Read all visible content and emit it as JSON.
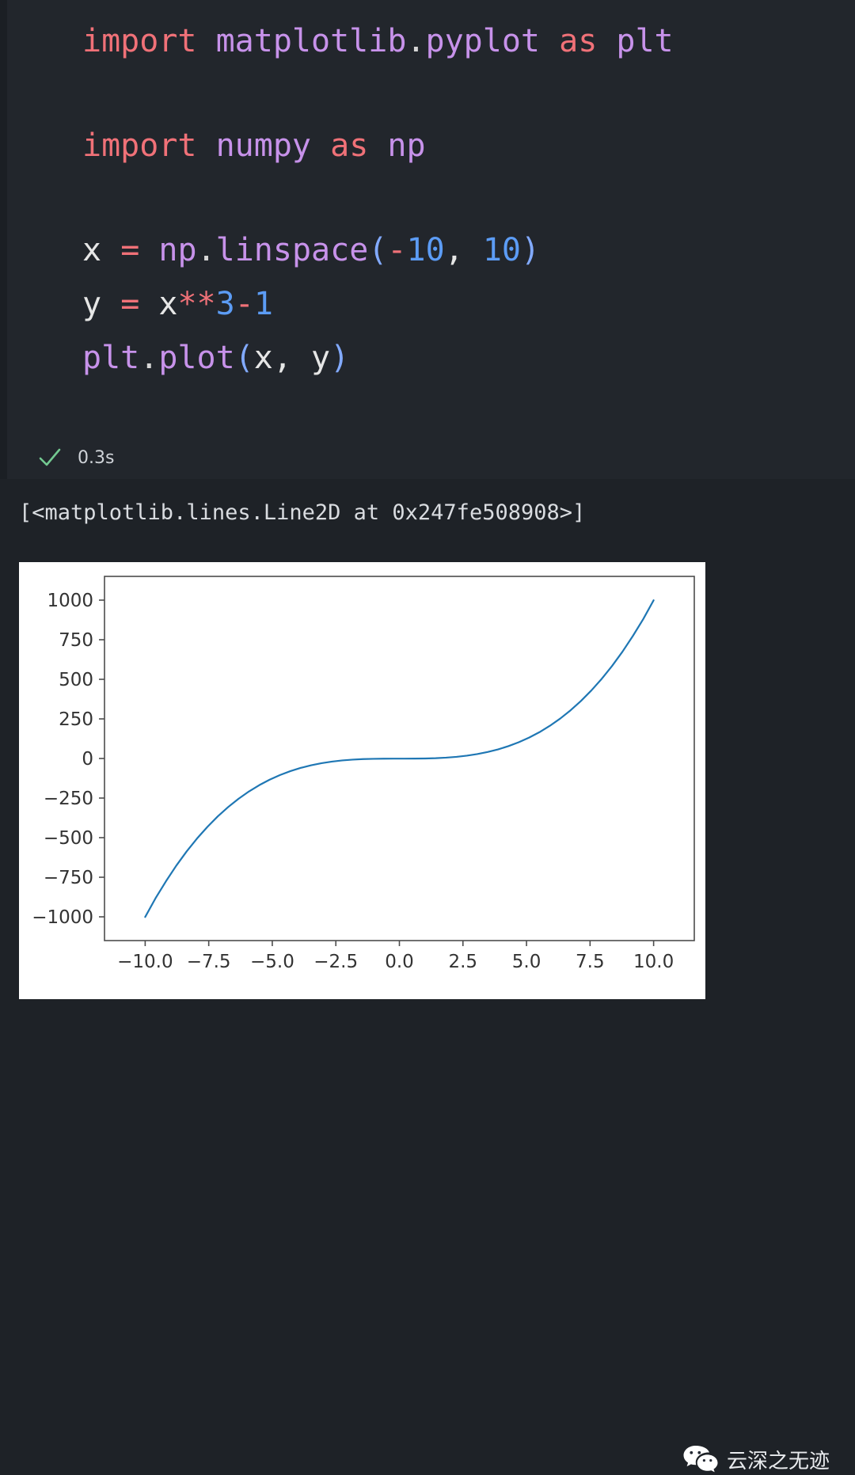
{
  "cell": {
    "code_lines": [
      {
        "id": "l1",
        "tokens": [
          {
            "t": "import",
            "c": "kw"
          },
          {
            "t": " ",
            "c": "plain"
          },
          {
            "t": "matplotlib",
            "c": "mod"
          },
          {
            "t": ".",
            "c": "plain"
          },
          {
            "t": "pyplot",
            "c": "mod"
          },
          {
            "t": " ",
            "c": "plain"
          },
          {
            "t": "as",
            "c": "kw"
          },
          {
            "t": " ",
            "c": "plain"
          },
          {
            "t": "plt",
            "c": "mod"
          }
        ]
      },
      {
        "id": "l2",
        "tokens": [
          {
            "t": "import",
            "c": "kw"
          },
          {
            "t": " ",
            "c": "plain"
          },
          {
            "t": "numpy",
            "c": "mod"
          },
          {
            "t": " ",
            "c": "plain"
          },
          {
            "t": "as",
            "c": "kw"
          },
          {
            "t": " ",
            "c": "plain"
          },
          {
            "t": "np",
            "c": "mod"
          }
        ]
      },
      {
        "id": "l3",
        "tokens": [
          {
            "t": "x",
            "c": "var"
          },
          {
            "t": " ",
            "c": "plain"
          },
          {
            "t": "=",
            "c": "op"
          },
          {
            "t": " ",
            "c": "plain"
          },
          {
            "t": "np",
            "c": "mod"
          },
          {
            "t": ".",
            "c": "plain"
          },
          {
            "t": "linspace",
            "c": "mod"
          },
          {
            "t": "(",
            "c": "punc"
          },
          {
            "t": "-",
            "c": "op"
          },
          {
            "t": "10",
            "c": "num"
          },
          {
            "t": ",",
            "c": "var"
          },
          {
            "t": " ",
            "c": "plain"
          },
          {
            "t": "10",
            "c": "num"
          },
          {
            "t": ")",
            "c": "punc"
          }
        ]
      },
      {
        "id": "l4",
        "tokens": [
          {
            "t": "y",
            "c": "var"
          },
          {
            "t": " ",
            "c": "plain"
          },
          {
            "t": "=",
            "c": "op"
          },
          {
            "t": " ",
            "c": "plain"
          },
          {
            "t": "x",
            "c": "var"
          },
          {
            "t": "**",
            "c": "op"
          },
          {
            "t": "3",
            "c": "num"
          },
          {
            "t": "-",
            "c": "op"
          },
          {
            "t": "1",
            "c": "num"
          }
        ]
      },
      {
        "id": "l5",
        "tokens": [
          {
            "t": "plt",
            "c": "mod"
          },
          {
            "t": ".",
            "c": "plain"
          },
          {
            "t": "plot",
            "c": "mod"
          },
          {
            "t": "(",
            "c": "punc"
          },
          {
            "t": "x",
            "c": "var"
          },
          {
            "t": ",",
            "c": "var"
          },
          {
            "t": " ",
            "c": "plain"
          },
          {
            "t": "y",
            "c": "var"
          },
          {
            "t": ")",
            "c": "punc"
          }
        ]
      }
    ],
    "code_plain": [
      "import matplotlib.pyplot as plt",
      "import numpy as np",
      "x = np.linspace(-10, 10)",
      "y = x**3-1",
      "plt.plot(x, y)"
    ],
    "status_icon": "check-icon",
    "status_color": "#73c991",
    "exec_time": "0.3s"
  },
  "output": {
    "repr_text": "[<matplotlib.lines.Line2D at 0x247fe508908>]"
  },
  "watermark": {
    "icon": "wechat-icon",
    "text": "云深之无迹"
  },
  "chart_data": {
    "type": "line",
    "title": "",
    "xlabel": "",
    "ylabel": "",
    "xlim": [
      -11.6,
      11.6
    ],
    "ylim": [
      -1150,
      1150
    ],
    "xticks": [
      "-10.0",
      "-7.5",
      "-5.0",
      "-2.5",
      "0.0",
      "2.5",
      "5.0",
      "7.5",
      "10.0"
    ],
    "xtick_values": [
      -10.0,
      -7.5,
      -5.0,
      -2.5,
      0.0,
      2.5,
      5.0,
      7.5,
      10.0
    ],
    "yticks": [
      "1000",
      "750",
      "500",
      "250",
      "0",
      "-250",
      "-500",
      "-750",
      "-1000"
    ],
    "ytick_values": [
      1000,
      750,
      500,
      250,
      0,
      -250,
      -500,
      -750,
      -1000
    ],
    "grid": false,
    "legend": false,
    "line_color": "#1f77b4",
    "line_width": 1.5,
    "series": [
      {
        "name": "y = x**3-1",
        "x": [
          -10.0,
          -9.59184,
          -9.18367,
          -8.77551,
          -8.36735,
          -7.95918,
          -7.55102,
          -7.14286,
          -6.73469,
          -6.32653,
          -5.91837,
          -5.5102,
          -5.10204,
          -4.69388,
          -4.28571,
          -3.87755,
          -3.46939,
          -3.06122,
          -2.65306,
          -2.2449,
          -1.83673,
          -1.42857,
          -1.02041,
          -0.61224,
          -0.20408,
          0.20408,
          0.61224,
          1.02041,
          1.42857,
          1.83673,
          2.2449,
          2.65306,
          3.06122,
          3.46939,
          3.87755,
          4.28571,
          4.69388,
          5.10204,
          5.5102,
          5.91837,
          6.32653,
          6.73469,
          7.14286,
          7.55102,
          7.95918,
          8.36735,
          8.77551,
          9.18367,
          9.59184,
          10.0
        ],
        "y": [
          -1001.0,
          -882.4,
          -775.7,
          -676.6,
          -586.6,
          -505.2,
          -431.7,
          -365.4,
          -306.5,
          -254.2,
          -208.3,
          -168.2,
          -133.8,
          -104.4,
          -79.7,
          -59.3,
          -42.8,
          -29.7,
          -19.7,
          -12.3,
          -7.2,
          -3.9,
          -2.1,
          -1.2,
          -1.0,
          -1.0,
          -0.8,
          0.1,
          1.9,
          5.2,
          10.3,
          17.7,
          27.7,
          40.8,
          57.3,
          77.7,
          102.4,
          131.8,
          166.2,
          206.3,
          252.2,
          304.5,
          363.4,
          429.7,
          503.2,
          584.6,
          674.6,
          773.7,
          880.4,
          999.0
        ]
      }
    ]
  }
}
